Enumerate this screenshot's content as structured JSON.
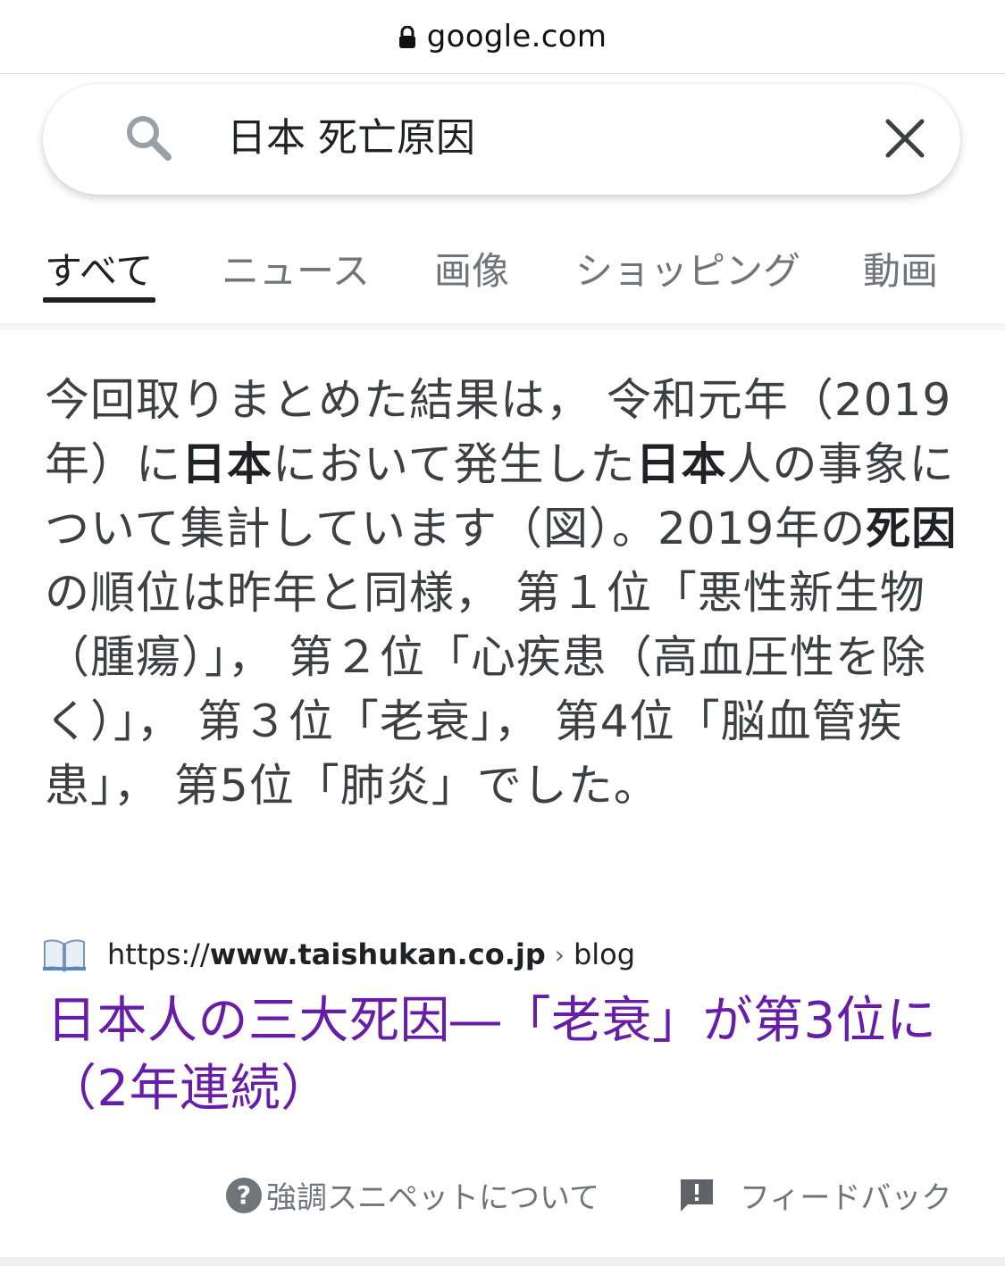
{
  "browser": {
    "domain": "google.com",
    "lock_icon": "lock-icon"
  },
  "search": {
    "query": "日本 死亡原因",
    "search_icon": "search-icon",
    "clear_icon": "close-icon"
  },
  "tabs": [
    {
      "label": "すべて",
      "active": true
    },
    {
      "label": "ニュース",
      "active": false
    },
    {
      "label": "画像",
      "active": false
    },
    {
      "label": "ショッピング",
      "active": false
    },
    {
      "label": "動画",
      "active": false
    }
  ],
  "snippet": {
    "segments": [
      {
        "text": "今回取りまとめた結果は， 令和元年（2019年）に",
        "bold": false
      },
      {
        "text": "日本",
        "bold": true
      },
      {
        "text": "において発生した",
        "bold": false
      },
      {
        "text": "日本",
        "bold": true
      },
      {
        "text": "人の事象について集計しています（図）。2019年の",
        "bold": false
      },
      {
        "text": "死因",
        "bold": true
      },
      {
        "text": "の順位は昨年と同様， 第１位「悪性新生物（腫瘍）」， 第２位「心疾患（高血圧性を除く）」， 第３位「老衰」， 第4位「脳血管疾患」， 第5位「肺炎」でした。",
        "bold": false
      }
    ]
  },
  "source": {
    "favicon": "book-icon",
    "url_prefix": "https://",
    "url_domain": "www.taishukan.co.jp",
    "separator": "›",
    "path": "blog"
  },
  "result": {
    "title": "日本人の三大死因―「老衰」が第3位に（2年連続）",
    "color": "#681da8"
  },
  "footer": {
    "help_label": "強調スニペットについて",
    "help_icon": "help-icon",
    "feedback_label": "フィードバック",
    "feedback_icon": "feedback-icon"
  }
}
